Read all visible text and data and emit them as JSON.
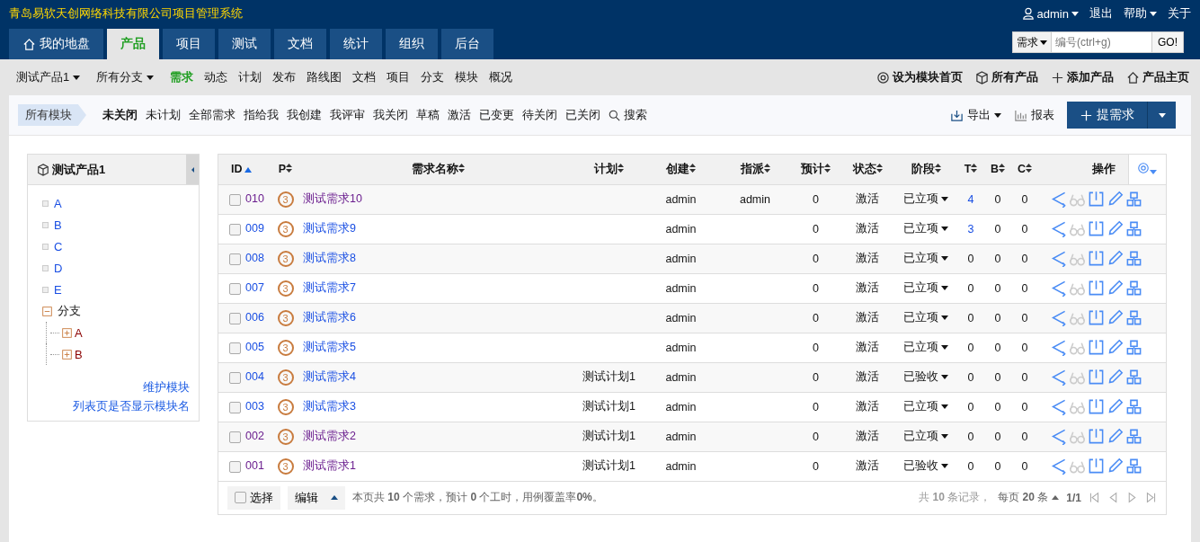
{
  "header": {
    "title": "青岛易软天创网络科技有限公司项目管理系统",
    "user": "admin",
    "links": [
      {
        "label": "退出",
        "dropdown": false
      },
      {
        "label": "帮助",
        "dropdown": true
      },
      {
        "label": "关于",
        "dropdown": false
      }
    ]
  },
  "main_tabs": [
    {
      "label": "我的地盘",
      "selected": false
    },
    {
      "label": "产品",
      "selected": true
    },
    {
      "label": "项目",
      "selected": false
    },
    {
      "label": "测试",
      "selected": false
    },
    {
      "label": "文档",
      "selected": false
    },
    {
      "label": "统计",
      "selected": false
    },
    {
      "label": "组织",
      "selected": false
    },
    {
      "label": "后台",
      "selected": false
    }
  ],
  "quick_search": {
    "type": "需求",
    "placeholder": "编号(ctrl+g)",
    "button": "GO!"
  },
  "subnav": {
    "product": "测试产品1",
    "branch": "所有分支",
    "items": [
      {
        "label": "需求",
        "selected": true
      },
      {
        "label": "动态",
        "selected": false
      },
      {
        "label": "计划",
        "selected": false
      },
      {
        "label": "发布",
        "selected": false
      },
      {
        "label": "路线图",
        "selected": false
      },
      {
        "label": "文档",
        "selected": false
      },
      {
        "label": "项目",
        "selected": false
      },
      {
        "label": "分支",
        "selected": false
      },
      {
        "label": "模块",
        "selected": false
      },
      {
        "label": "概况",
        "selected": false
      }
    ],
    "actions": [
      {
        "kind": "settings",
        "label": "设为模块首页"
      },
      {
        "kind": "box",
        "label": "所有产品"
      },
      {
        "kind": "add",
        "label": "添加产品"
      },
      {
        "kind": "home",
        "label": "产品主页"
      }
    ]
  },
  "filter": {
    "module": "所有模块",
    "items": [
      {
        "label": "未关闭",
        "selected": true
      },
      {
        "label": "未计划",
        "selected": false
      },
      {
        "label": "全部需求",
        "selected": false
      },
      {
        "label": "指给我",
        "selected": false
      },
      {
        "label": "我创建",
        "selected": false
      },
      {
        "label": "我评审",
        "selected": false
      },
      {
        "label": "我关闭",
        "selected": false
      },
      {
        "label": "草稿",
        "selected": false
      },
      {
        "label": "激活",
        "selected": false
      },
      {
        "label": "已变更",
        "selected": false
      },
      {
        "label": "待关闭",
        "selected": false
      },
      {
        "label": "已关闭",
        "selected": false
      }
    ],
    "search": "搜索",
    "export": "导出",
    "report": "报表",
    "create": "提需求"
  },
  "sidebar": {
    "title": "测试产品1",
    "modules": [
      {
        "label": "A"
      },
      {
        "label": "B"
      },
      {
        "label": "C"
      },
      {
        "label": "D"
      },
      {
        "label": "E"
      },
      {
        "label": "分支",
        "expanded": true,
        "children": [
          {
            "label": "A",
            "expanded": false
          },
          {
            "label": "B",
            "expanded": false
          }
        ]
      }
    ],
    "links": [
      "维护模块",
      "列表页是否显示模块名"
    ]
  },
  "table": {
    "columns": [
      {
        "label": "ID",
        "sortable": true,
        "sorted_ascending": true
      },
      {
        "label": "P",
        "sortable": true,
        "sorted_ascending": false
      },
      {
        "label": "需求名称",
        "sortable": true,
        "sorted_ascending": false
      },
      {
        "label": "计划",
        "sortable": true,
        "sorted_ascending": false
      },
      {
        "label": "创建",
        "sortable": true,
        "sorted_ascending": false
      },
      {
        "label": "指派",
        "sortable": true,
        "sorted_ascending": false
      },
      {
        "label": "预计",
        "sortable": true,
        "sorted_ascending": false
      },
      {
        "label": "状态",
        "sortable": true,
        "sorted_ascending": false
      },
      {
        "label": "阶段",
        "sortable": true,
        "sorted_ascending": false
      },
      {
        "label": "T",
        "sortable": true,
        "sorted_ascending": false
      },
      {
        "label": "B",
        "sortable": true,
        "sorted_ascending": false
      },
      {
        "label": "C",
        "sortable": true,
        "sorted_ascending": false
      },
      {
        "label": "操作",
        "sortable": false
      }
    ],
    "rows": [
      {
        "id": "010",
        "pri": "3",
        "name": "测试需求10",
        "plan": "",
        "creator": "admin",
        "assignee": "admin",
        "estimate": "0",
        "status": "激活",
        "stage": "已立项",
        "t": "4",
        "t_linked": true,
        "b": "0",
        "c": "0",
        "visited": true,
        "checked": false,
        "reviewable": false
      },
      {
        "id": "009",
        "pri": "3",
        "name": "测试需求9",
        "plan": "",
        "creator": "admin",
        "assignee": "",
        "estimate": "0",
        "status": "激活",
        "stage": "已立项",
        "t": "3",
        "t_linked": true,
        "b": "0",
        "c": "0",
        "visited": false,
        "checked": false,
        "reviewable": false
      },
      {
        "id": "008",
        "pri": "3",
        "name": "测试需求8",
        "plan": "",
        "creator": "admin",
        "assignee": "",
        "estimate": "0",
        "status": "激活",
        "stage": "已立项",
        "t": "0",
        "t_linked": false,
        "b": "0",
        "c": "0",
        "visited": false,
        "checked": false,
        "reviewable": false
      },
      {
        "id": "007",
        "pri": "3",
        "name": "测试需求7",
        "plan": "",
        "creator": "admin",
        "assignee": "",
        "estimate": "0",
        "status": "激活",
        "stage": "已立项",
        "t": "0",
        "t_linked": false,
        "b": "0",
        "c": "0",
        "visited": false,
        "checked": false,
        "reviewable": false
      },
      {
        "id": "006",
        "pri": "3",
        "name": "测试需求6",
        "plan": "",
        "creator": "admin",
        "assignee": "",
        "estimate": "0",
        "status": "激活",
        "stage": "已立项",
        "t": "0",
        "t_linked": false,
        "b": "0",
        "c": "0",
        "visited": false,
        "checked": false,
        "reviewable": false
      },
      {
        "id": "005",
        "pri": "3",
        "name": "测试需求5",
        "plan": "",
        "creator": "admin",
        "assignee": "",
        "estimate": "0",
        "status": "激活",
        "stage": "已立项",
        "t": "0",
        "t_linked": false,
        "b": "0",
        "c": "0",
        "visited": false,
        "checked": false,
        "reviewable": false
      },
      {
        "id": "004",
        "pri": "3",
        "name": "测试需求4",
        "plan": "测试计划1",
        "creator": "admin",
        "assignee": "",
        "estimate": "0",
        "status": "激活",
        "stage": "已验收",
        "t": "0",
        "t_linked": false,
        "b": "0",
        "c": "0",
        "visited": false,
        "checked": false,
        "reviewable": false
      },
      {
        "id": "003",
        "pri": "3",
        "name": "测试需求3",
        "plan": "测试计划1",
        "creator": "admin",
        "assignee": "",
        "estimate": "0",
        "status": "激活",
        "stage": "已立项",
        "t": "0",
        "t_linked": false,
        "b": "0",
        "c": "0",
        "visited": false,
        "checked": false,
        "reviewable": false
      },
      {
        "id": "002",
        "pri": "3",
        "name": "测试需求2",
        "plan": "测试计划1",
        "creator": "admin",
        "assignee": "",
        "estimate": "0",
        "status": "激活",
        "stage": "已立项",
        "t": "0",
        "t_linked": false,
        "b": "0",
        "c": "0",
        "visited": true,
        "checked": false,
        "reviewable": false
      },
      {
        "id": "001",
        "pri": "3",
        "name": "测试需求1",
        "plan": "测试计划1",
        "creator": "admin",
        "assignee": "",
        "estimate": "0",
        "status": "激活",
        "stage": "已验收",
        "t": "0",
        "t_linked": false,
        "b": "0",
        "c": "0",
        "visited": true,
        "checked": false,
        "reviewable": false
      }
    ],
    "footer": {
      "select_all": "选择",
      "select_all_checked": false,
      "edit": "编辑",
      "summary": "本页共 **10** 个需求，预计 **0** 个工时，用例覆盖率**0%**。",
      "records": "共 **10** 条记录，",
      "per_page": "每页 **20** 条",
      "pages": "1/1"
    }
  }
}
